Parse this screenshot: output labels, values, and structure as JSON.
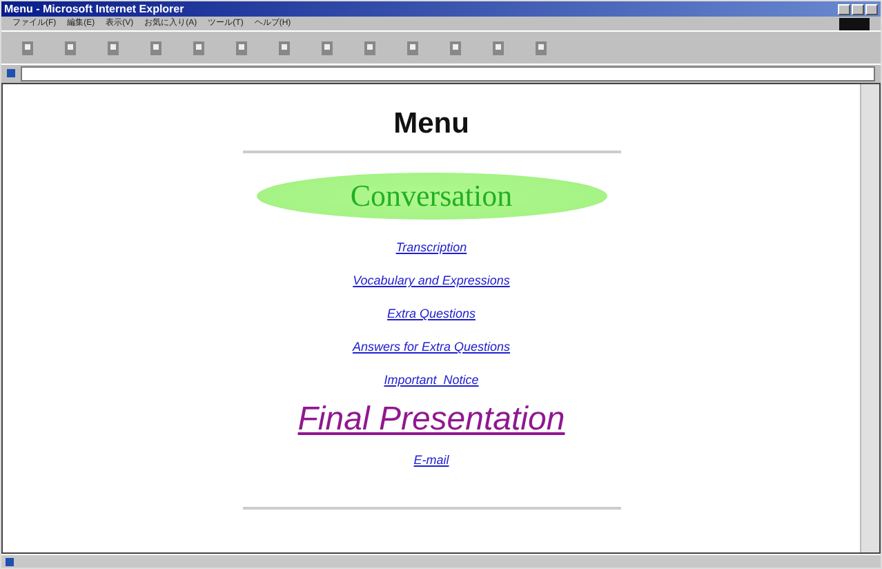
{
  "window": {
    "title": "Menu - Microsoft Internet Explorer"
  },
  "menu_bar": [
    "ファイル(F)",
    "編集(E)",
    "表示(V)",
    "お気に入り(A)",
    "ツール(T)",
    "ヘルプ(H)"
  ],
  "page": {
    "heading": "Menu",
    "feature": "Conversation",
    "links": [
      {
        "label": "Transcription",
        "kind": "small"
      },
      {
        "label": "Vocabulary and Expressions",
        "kind": "small"
      },
      {
        "label": "Extra Questions",
        "kind": "small"
      },
      {
        "label": "Answers for Extra Questions",
        "kind": "small"
      },
      {
        "label": "Important  Notice",
        "kind": "small"
      },
      {
        "label": "Final Presentation",
        "kind": "large"
      },
      {
        "label": "E-mail",
        "kind": "small"
      }
    ]
  }
}
